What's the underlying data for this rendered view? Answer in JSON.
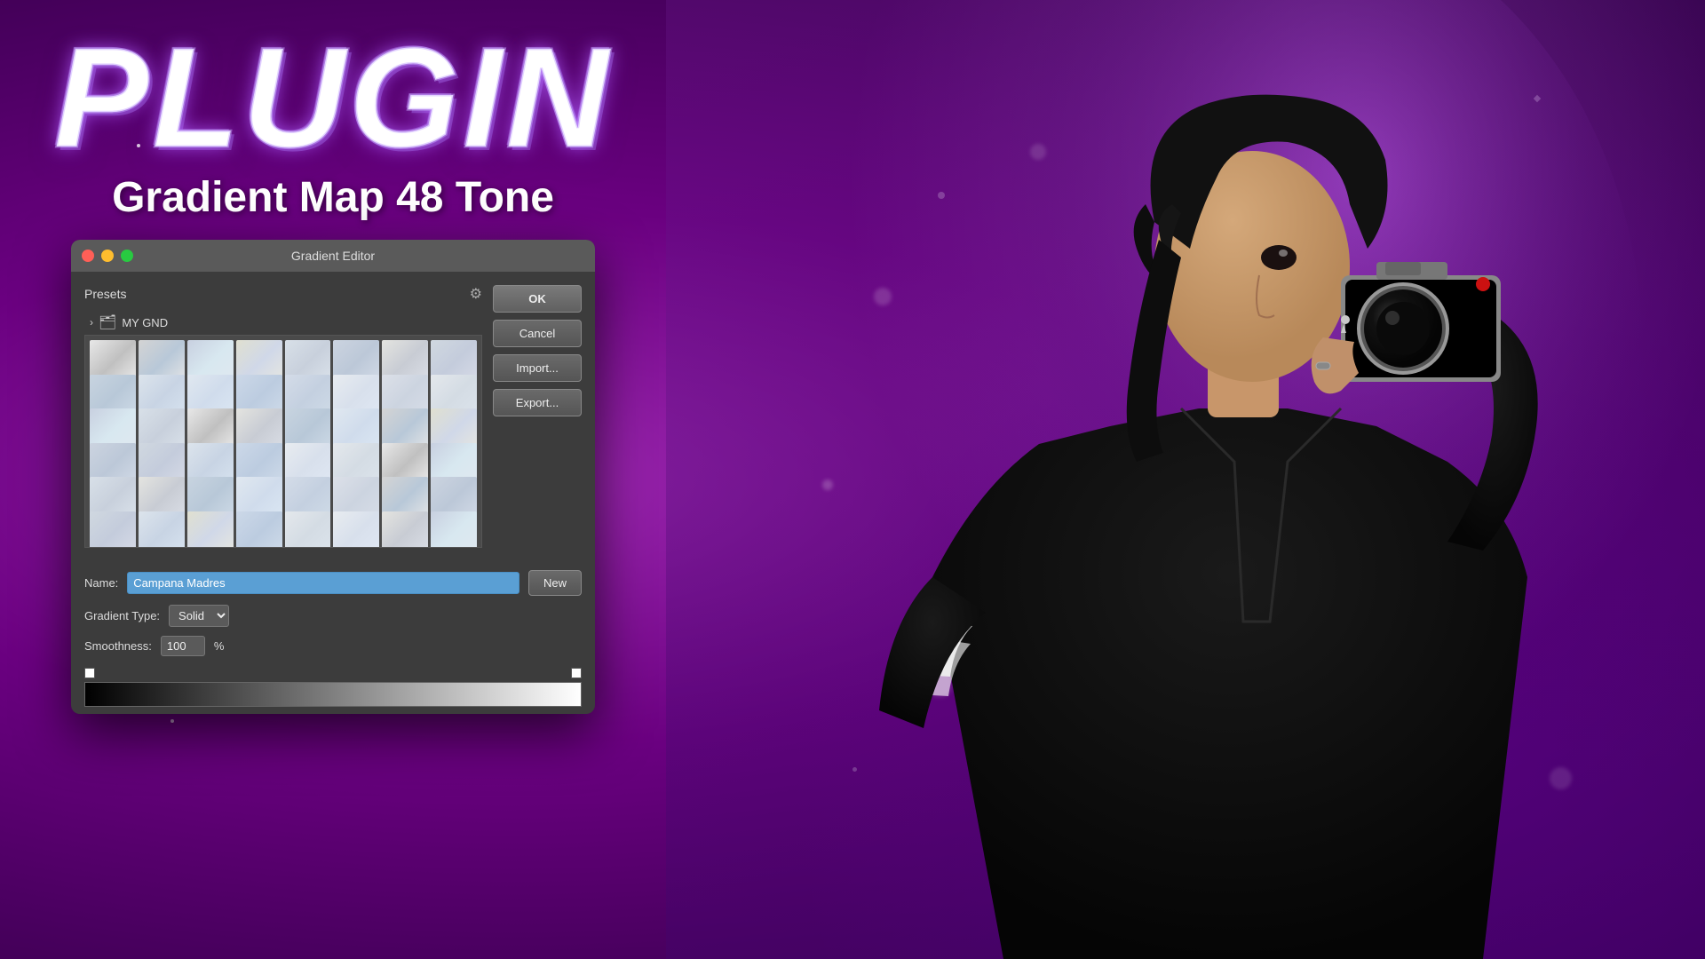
{
  "title": {
    "plugin_text": "PLUGIN",
    "subtitle_text": "Gradient Map 48 Tone"
  },
  "dialog": {
    "title": "Gradient Editor",
    "traffic_lights": [
      "red",
      "yellow",
      "green"
    ],
    "presets_label": "Presets",
    "folder_name": "MY GND",
    "buttons": {
      "ok": "OK",
      "cancel": "Cancel",
      "import": "Import...",
      "export": "Export..."
    },
    "name_label": "Name:",
    "name_value": "Campana Madres",
    "new_button": "New",
    "gradient_type_label": "Gradient Type:",
    "gradient_type_value": "Solid",
    "smoothness_label": "Smoothness:",
    "smoothness_value": "100",
    "smoothness_unit": "%",
    "gear_icon": "⚙",
    "chevron_icon": "›",
    "folder_icon": "📁"
  },
  "colors": {
    "background_purple": "#7b1fa2",
    "dialog_bg": "#3c3c3c",
    "title_bar_bg": "#5a5a5a",
    "button_bg": "#606060",
    "name_input_bg": "#5a9fd4",
    "accent_purple": "#9c27b0"
  }
}
